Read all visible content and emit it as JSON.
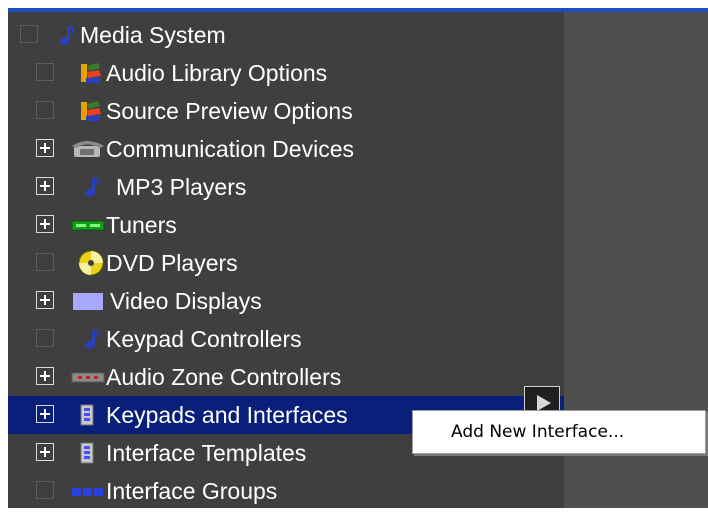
{
  "tree": {
    "root": {
      "label": "Media System",
      "icon": "music-note-icon"
    },
    "items": [
      {
        "label": "Audio Library Options",
        "icon": "colored-speaker-icon",
        "expandable": false
      },
      {
        "label": "Source Preview Options",
        "icon": "colored-speaker-icon",
        "expandable": false
      },
      {
        "label": "Communication Devices",
        "icon": "telephone-icon",
        "expandable": true
      },
      {
        "label": "MP3 Players",
        "icon": "music-note-icon",
        "expandable": true
      },
      {
        "label": "Tuners",
        "icon": "tuner-icon",
        "expandable": true
      },
      {
        "label": "DVD Players",
        "icon": "disc-icon",
        "expandable": false
      },
      {
        "label": "Video Displays",
        "icon": "display-icon",
        "expandable": true
      },
      {
        "label": "Keypad Controllers",
        "icon": "music-note-icon",
        "expandable": false
      },
      {
        "label": "Audio Zone Controllers",
        "icon": "zone-controller-icon",
        "expandable": true
      },
      {
        "label": "Keypads and Interfaces",
        "icon": "keypad-icon",
        "expandable": true,
        "selected": true
      },
      {
        "label": "Interface Templates",
        "icon": "keypad-icon",
        "expandable": true
      },
      {
        "label": "Interface Groups",
        "icon": "interface-group-icon",
        "expandable": false
      }
    ]
  },
  "context_menu": {
    "items": [
      {
        "label": "Add New Interface..."
      }
    ]
  },
  "colors": {
    "panel_bg": "#3f3f3f",
    "selection": "#0a1f7a",
    "accent_top": "#1f4fbf"
  }
}
